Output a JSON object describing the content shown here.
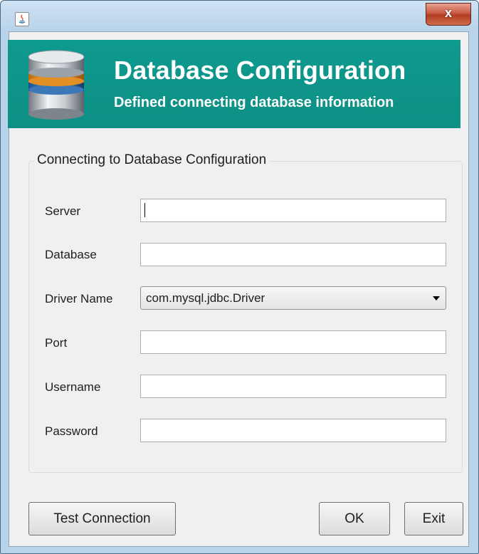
{
  "window": {
    "close_label": "x"
  },
  "banner": {
    "title": "Database Configuration",
    "subtitle": "Defined connecting database information",
    "accent_color": "#0d9488",
    "icon": "database-icon"
  },
  "form": {
    "group_title": "Connecting to Database Configuration",
    "fields": {
      "server": {
        "label": "Server",
        "value": ""
      },
      "database": {
        "label": "Database",
        "value": ""
      },
      "driver": {
        "label": "Driver Name",
        "value": "com.mysql.jdbc.Driver"
      },
      "port": {
        "label": "Port",
        "value": ""
      },
      "username": {
        "label": "Username",
        "value": ""
      },
      "password": {
        "label": "Password",
        "value": ""
      }
    }
  },
  "buttons": {
    "test_connection": "Test Connection",
    "ok": "OK",
    "exit": "Exit"
  }
}
